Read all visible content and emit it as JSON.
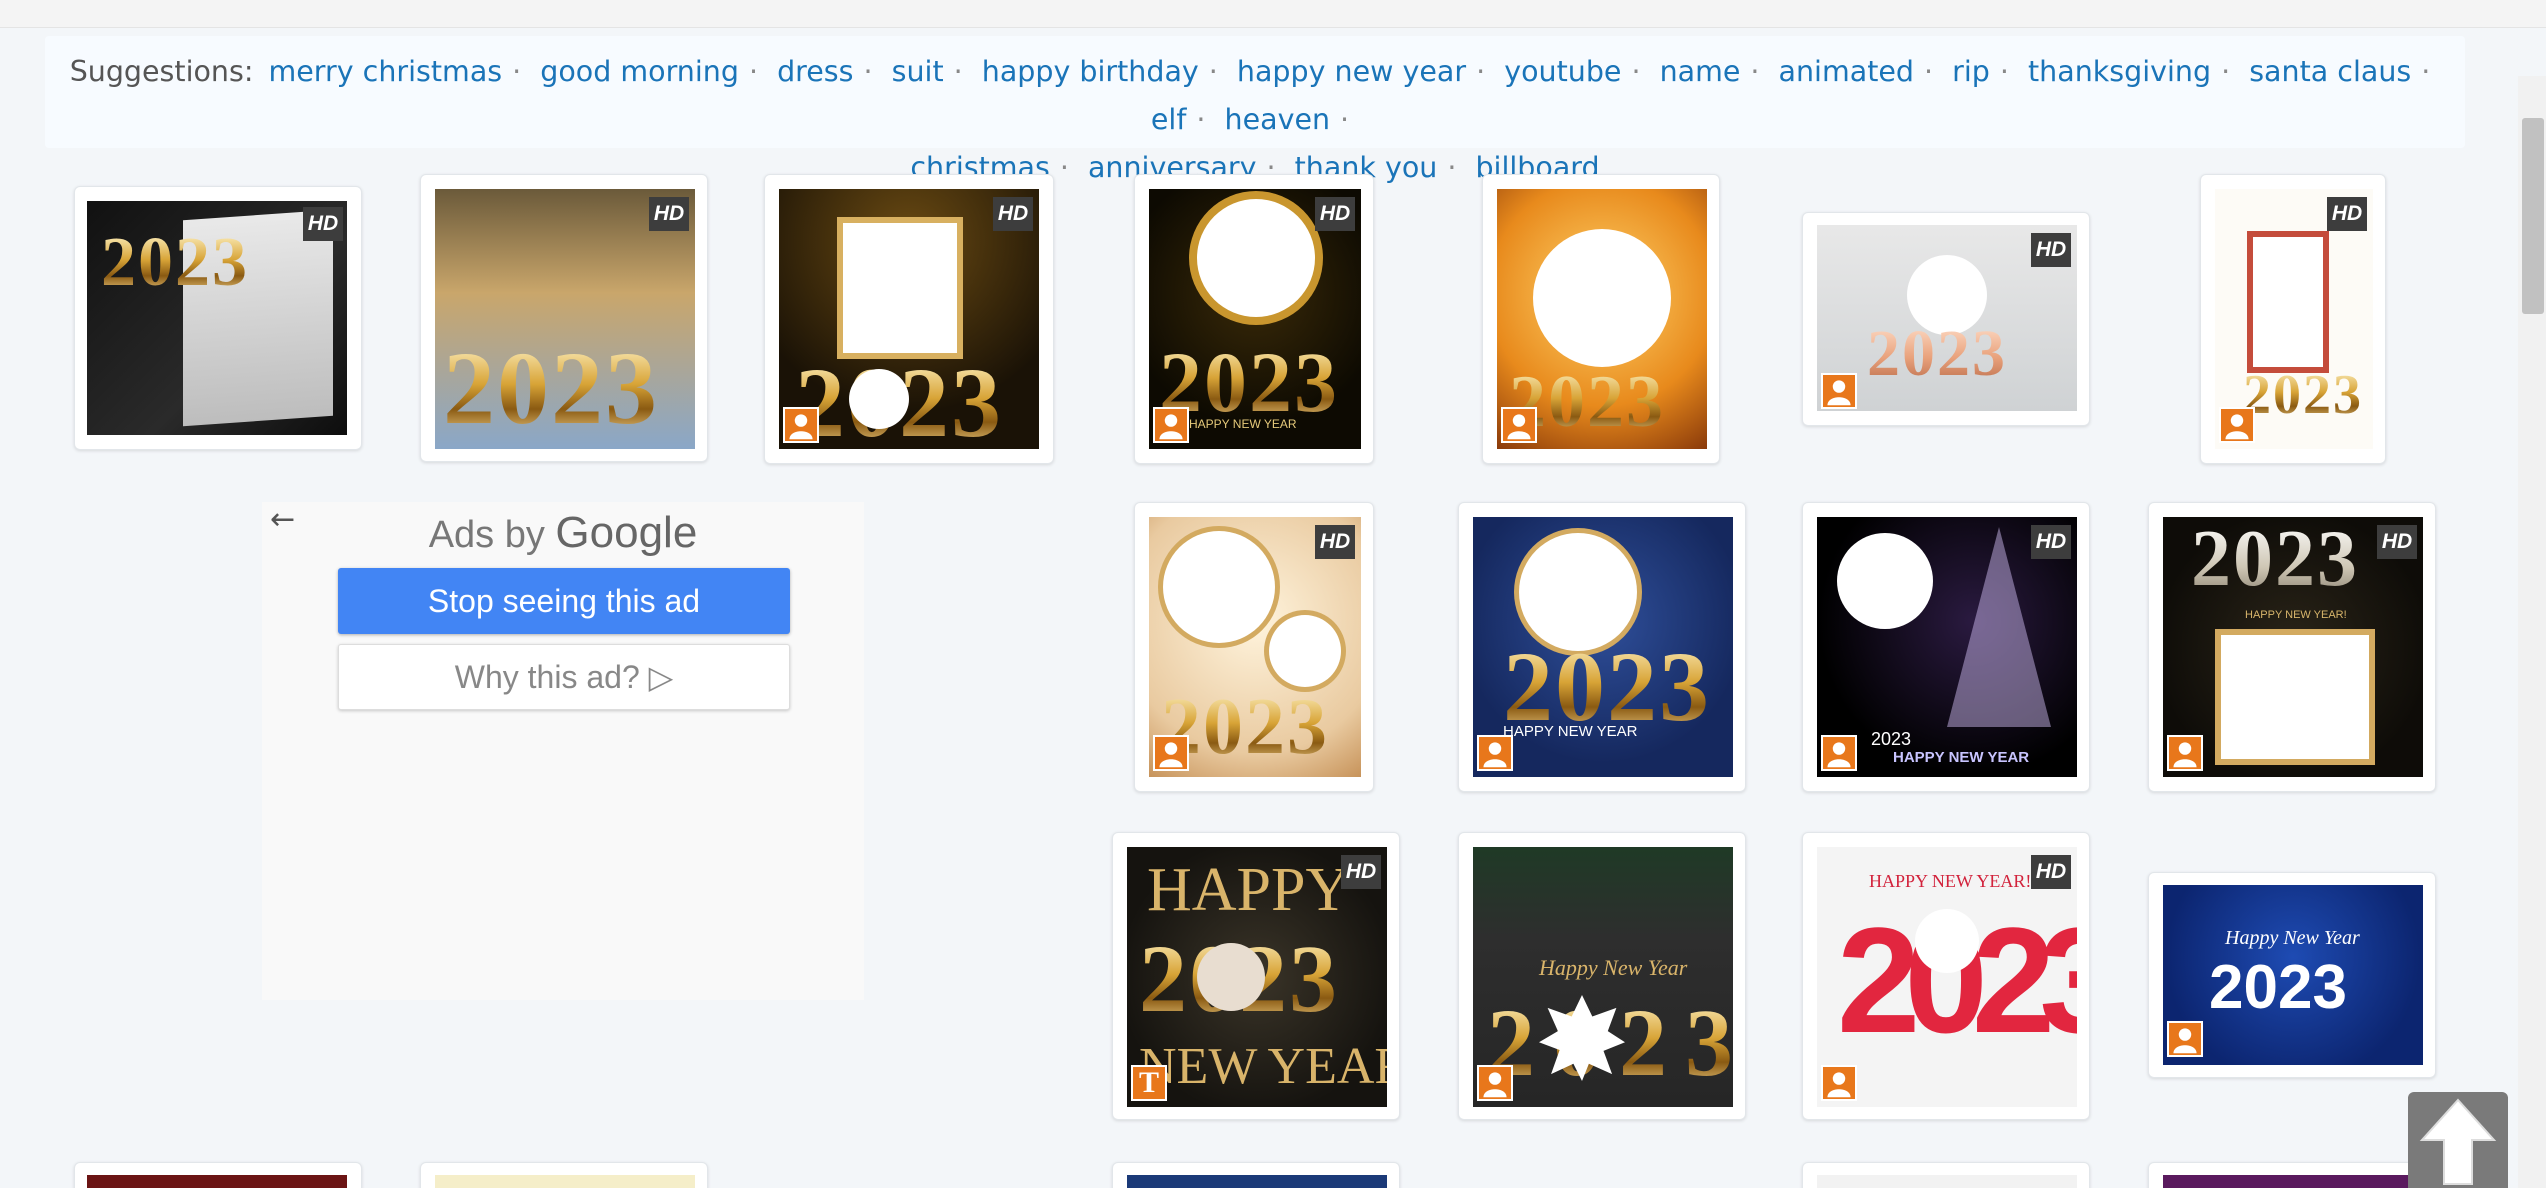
{
  "suggestions": {
    "label": "Suggestions:",
    "items": [
      "merry christmas",
      "good morning",
      "dress",
      "suit",
      "happy birthday",
      "happy new year",
      "youtube",
      "name",
      "animated",
      "rip",
      "thanksgiving",
      "santa claus",
      "elf",
      "heaven",
      "christmas",
      "anniversary",
      "thank you",
      "billboard"
    ]
  },
  "hd_label": "HD",
  "thumbs": {
    "year": "2023",
    "hny_caption": "HAPPY NEW YEAR",
    "hny_caption_short": "HAPPY NEW YEAR!",
    "happy": "HAPPY",
    "new_year": "NEW YEAR",
    "script_hny": "Happy New Year"
  },
  "ad": {
    "back_glyph": "←",
    "ads_by": "Ads by",
    "google": "Google",
    "stop_label": "Stop seeing this ad",
    "why_label": "Why this ad? ▷"
  },
  "badge_text_t": "T",
  "colors": {
    "link": "#1a74b8",
    "badge": "#e8771b",
    "ad_button": "#4285f4"
  }
}
